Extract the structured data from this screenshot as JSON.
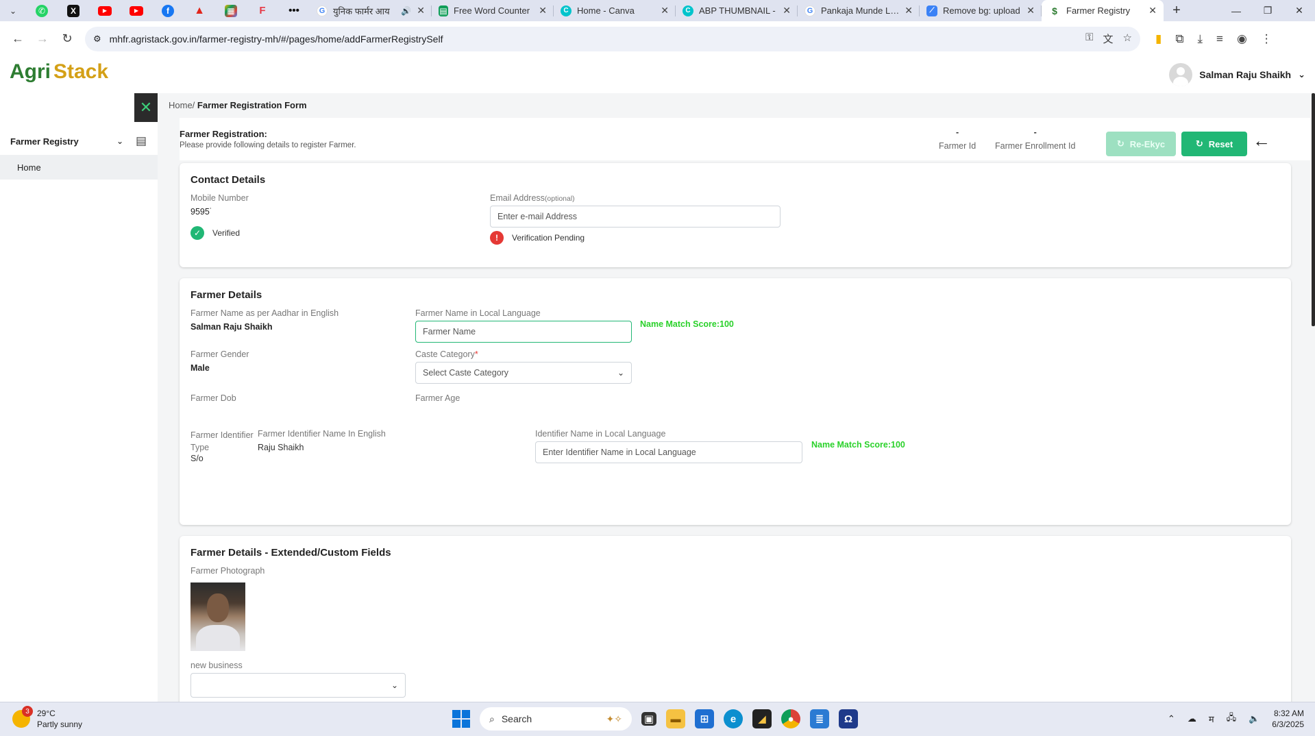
{
  "browser": {
    "tabs": [
      {
        "title": "युनिक फार्मर आय",
        "favicon": "google-icon"
      },
      {
        "title": "Free Word Counter",
        "favicon": "sheets-icon"
      },
      {
        "title": "Home - Canva",
        "favicon": "canva-icon"
      },
      {
        "title": "ABP THUMBNAIL -",
        "favicon": "canva-icon"
      },
      {
        "title": "Pankaja Munde LIVE",
        "favicon": "google-icon"
      },
      {
        "title": "Remove bg: upload",
        "favicon": "removebg-icon"
      },
      {
        "title": "Farmer Registry",
        "favicon": "agristack-icon"
      }
    ],
    "url": "mhfr.agristack.gov.in/farmer-registry-mh/#/pages/home/addFarmerRegistrySelf"
  },
  "header": {
    "logo_part1": "Agri",
    "logo_part2": "Stack",
    "user_name": "Salman Raju Shaikh"
  },
  "sidebar": {
    "section": "Farmer Registry",
    "items": [
      {
        "label": "Home"
      }
    ]
  },
  "breadcrumb": {
    "home": "Home/",
    "current": "Farmer Registration Form"
  },
  "form_header": {
    "title": "Farmer Registration:",
    "subtitle": "Please provide following details to register Farmer.",
    "farmer_id_value": "-",
    "farmer_id_label": "Farmer Id",
    "enrollment_value": "-",
    "enrollment_label": "Farmer Enrollment Id",
    "reekyc_label": "Re-Ekyc",
    "reset_label": "Reset"
  },
  "contact": {
    "title": "Contact Details",
    "mobile_label": "Mobile Number",
    "mobile_value": "9595˙",
    "mobile_status": "Verified",
    "email_label": "Email Address",
    "email_optional": "(optional)",
    "email_placeholder": "Enter e-mail Address",
    "email_status": "Verification Pending"
  },
  "farmer": {
    "title": "Farmer Details",
    "name_en_label": "Farmer Name as per Aadhar in English",
    "name_en_value": "Salman Raju Shaikh",
    "name_local_label": "Farmer Name in Local Language",
    "name_local_placeholder": "Farmer Name",
    "name_match": "Name Match Score:100",
    "gender_label": "Farmer Gender",
    "gender_value": "Male",
    "caste_label": "Caste Category",
    "caste_required": "*",
    "caste_placeholder": "Select Caste Category",
    "dob_label": "Farmer Dob",
    "age_label": "Farmer Age",
    "identifier_type_label_1": "Farmer Identifier",
    "identifier_type_label_2": "Type",
    "identifier_type_value": "S/o",
    "identifier_name_label": "Farmer Identifier Name In English",
    "identifier_name_value": "Raju Shaikh",
    "identifier_local_label": "Identifier Name in Local Language",
    "identifier_local_placeholder": "Enter Identifier Name in Local Language",
    "identifier_match": "Name Match Score:100"
  },
  "extended": {
    "title": "Farmer Details - Extended/Custom Fields",
    "photo_label": "Farmer Photograph",
    "business_label": "new business"
  },
  "taskbar": {
    "weather_badge": "3",
    "temperature": "29°C",
    "weather_text": "Partly sunny",
    "search_label": "Search",
    "ime_label": "म",
    "time": "8:32 AM",
    "date": "6/3/2025"
  },
  "colors": {
    "accent_green": "#21b775",
    "match_green": "#2ad12a",
    "error_red": "#e53935"
  }
}
